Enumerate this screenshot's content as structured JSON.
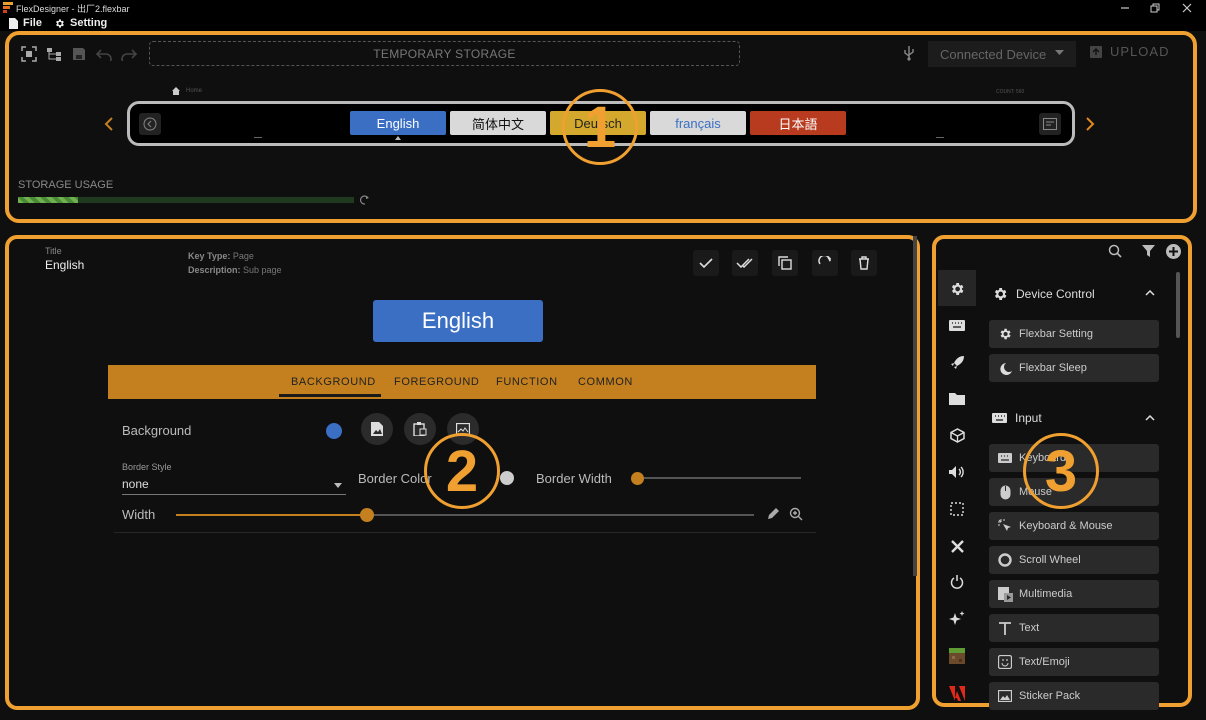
{
  "window": {
    "title": "FlexDesigner - 出厂2.flexbar"
  },
  "menu": {
    "file": "File",
    "setting": "Setting"
  },
  "toolbar": {
    "storage_label": "TEMPORARY STORAGE",
    "connected_device": "Connected Device",
    "upload": "UPLOAD"
  },
  "flexbar": {
    "breadcrumb": "Home",
    "count": "COUNT: 560",
    "keys": [
      {
        "label": "English",
        "bg": "#3a6fc4",
        "fg": "#ffffff"
      },
      {
        "label": "简体中文",
        "bg": "#d9d9d9",
        "fg": "#111111"
      },
      {
        "label": "Deutsch",
        "bg": "#d4a82c",
        "fg": "#222222"
      },
      {
        "label": "français",
        "bg": "#d9d9d9",
        "fg": "#3a6fc4"
      },
      {
        "label": "日本語",
        "bg": "#b83a1f",
        "fg": "#ffffff"
      }
    ]
  },
  "storage_usage": {
    "label": "STORAGE USAGE",
    "fraction": 0.18
  },
  "editor": {
    "title_label": "Title",
    "title_value": "English",
    "key_type_label": "Key Type:",
    "key_type_value": "Page",
    "description_label": "Description:",
    "description_value": "Sub page",
    "preview_label": "English",
    "tabs": [
      "BACKGROUND",
      "FOREGROUND",
      "FUNCTION",
      "COMMON"
    ],
    "active_tab": "BACKGROUND",
    "background_label": "Background",
    "background_color": "#3a6fc4",
    "border_style_label": "Border Style",
    "border_style_value": "none",
    "border_color_label": "Border Color",
    "border_width_label": "Border Width",
    "border_width_value": 0,
    "width_label": "Width",
    "width_fraction": 0.33
  },
  "library": {
    "groups": [
      {
        "name": "Device Control",
        "icon": "gear-icon",
        "items": [
          {
            "label": "Flexbar Setting",
            "icon": "gear-icon"
          },
          {
            "label": "Flexbar Sleep",
            "icon": "moon-icon"
          }
        ]
      },
      {
        "name": "Input",
        "icon": "keyboard-icon",
        "items": [
          {
            "label": "Keyboard",
            "icon": "keyboard-icon"
          },
          {
            "label": "Mouse",
            "icon": "mouse-icon"
          },
          {
            "label": "Keyboard & Mouse",
            "icon": "click-icon"
          },
          {
            "label": "Scroll Wheel",
            "icon": "scroll-wheel-icon"
          },
          {
            "label": "Multimedia",
            "icon": "multimedia-icon"
          },
          {
            "label": "Text",
            "icon": "text-icon"
          },
          {
            "label": "Text/Emoji",
            "icon": "emoji-icon"
          },
          {
            "label": "Sticker Pack",
            "icon": "sticker-icon"
          }
        ]
      }
    ]
  },
  "annotations": [
    "1",
    "2",
    "3"
  ],
  "colors": {
    "accent_frame": "#f0a030",
    "tab_bar": "#c4801e",
    "preview_key": "#3a6fc4"
  }
}
